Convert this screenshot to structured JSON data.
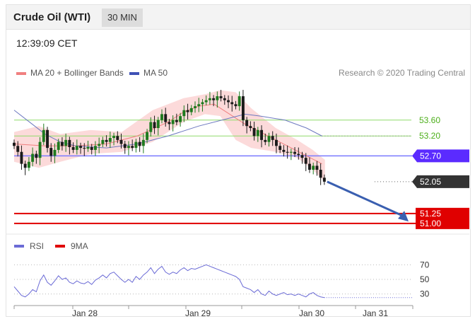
{
  "header": {
    "title": "Crude Oil (WTI)",
    "interval": "30 MIN"
  },
  "timestamp": "12:39:09 CET",
  "legend": {
    "ma20": {
      "label": "MA 20 + Bollinger Bands",
      "color": "#f08080"
    },
    "ma50": {
      "label": "MA 50",
      "color": "#3f51b5"
    },
    "rsi": {
      "label": "RSI",
      "color": "#6b6bd6"
    },
    "ma9": {
      "label": "9MA",
      "color": "#e00000"
    }
  },
  "credit": "Research © 2020 Trading Central",
  "colors": {
    "up": "#1e7a1e",
    "down": "#1a1a1a",
    "band": "#fbd3d3",
    "green_level": "#8fdc6a",
    "blue_level": "#7a7aff",
    "red_level": "#e00000",
    "dark_tag": "#333333",
    "purple_tag": "#5b2bff",
    "arrow": "#3a5fb0"
  },
  "chart_data": [
    {
      "type": "line",
      "name": "price",
      "x_ticks": [
        "Jan 28",
        "Jan 29",
        "Jan 30",
        "Jan 31"
      ],
      "levels": [
        {
          "value": 53.6,
          "label": "53.60",
          "style": "green"
        },
        {
          "value": 53.2,
          "label": "53.20",
          "style": "green"
        },
        {
          "value": 52.7,
          "label": "52.70",
          "style": "blue-tag"
        },
        {
          "value": 52.05,
          "label": "52.05",
          "style": "dark-tag"
        },
        {
          "value": 51.25,
          "label": "51.25",
          "style": "red-tag"
        },
        {
          "value": 51.0,
          "label": "51.00",
          "style": "red-tag"
        }
      ],
      "ylim": [
        50.82,
        54.45
      ],
      "xlim": [
        0,
        130
      ],
      "close": [
        52.95,
        52.8,
        52.5,
        52.4,
        52.55,
        52.75,
        52.65,
        53.05,
        53.35,
        52.9,
        52.7,
        52.85,
        53.05,
        52.95,
        53.1,
        52.92,
        52.85,
        52.95,
        52.9,
        52.88,
        52.92,
        52.85,
        52.95,
        53.0,
        53.1,
        53.05,
        53.15,
        53.2,
        53.1,
        53.0,
        52.9,
        52.95,
        52.9,
        53.05,
        52.95,
        53.1,
        53.3,
        53.55,
        53.4,
        53.6,
        53.75,
        53.55,
        53.5,
        53.6,
        53.55,
        53.7,
        53.85,
        53.8,
        53.9,
        53.95,
        54.0,
        54.05,
        54.1,
        54.15,
        54.1,
        54.2,
        54.15,
        54.1,
        54.05,
        54.0,
        53.95,
        54.2,
        53.6,
        53.45,
        53.4,
        53.2,
        53.35,
        53.1,
        53.05,
        53.2,
        53.1,
        52.95,
        52.85,
        52.8,
        52.78,
        52.8,
        52.75,
        52.72,
        52.65,
        52.5,
        52.35,
        52.45,
        52.35,
        52.15,
        52.05
      ],
      "x_start": 0,
      "x_step": 1.2,
      "ma20": [
        [
          0,
          53.0
        ],
        [
          10,
          52.95
        ],
        [
          20,
          52.95
        ],
        [
          30,
          53.0
        ],
        [
          40,
          53.2
        ],
        [
          50,
          53.55
        ],
        [
          55,
          53.8
        ],
        [
          60,
          53.95
        ],
        [
          65,
          54.0
        ],
        [
          70,
          53.75
        ],
        [
          75,
          53.5
        ],
        [
          80,
          53.3
        ],
        [
          85,
          53.1
        ],
        [
          90,
          52.9
        ],
        [
          95,
          52.7
        ],
        [
          100,
          52.5
        ]
      ],
      "band_upper": [
        [
          0,
          53.3
        ],
        [
          8,
          53.45
        ],
        [
          15,
          53.25
        ],
        [
          25,
          53.35
        ],
        [
          35,
          53.3
        ],
        [
          45,
          53.85
        ],
        [
          55,
          54.15
        ],
        [
          62,
          54.25
        ],
        [
          67,
          54.35
        ],
        [
          72,
          54.3
        ],
        [
          77,
          53.9
        ],
        [
          85,
          53.4
        ],
        [
          92,
          53.1
        ],
        [
          97,
          52.85
        ],
        [
          101,
          52.6
        ]
      ],
      "band_lower": [
        [
          0,
          52.55
        ],
        [
          8,
          52.4
        ],
        [
          15,
          52.55
        ],
        [
          25,
          52.75
        ],
        [
          35,
          52.8
        ],
        [
          45,
          53.05
        ],
        [
          55,
          53.55
        ],
        [
          62,
          53.75
        ],
        [
          67,
          53.7
        ],
        [
          72,
          53.1
        ],
        [
          77,
          52.9
        ],
        [
          85,
          52.8
        ],
        [
          92,
          52.65
        ],
        [
          97,
          52.35
        ],
        [
          101,
          52.05
        ]
      ],
      "ma50": [
        [
          0,
          53.85
        ],
        [
          5,
          53.55
        ],
        [
          10,
          53.25
        ],
        [
          15,
          53.05
        ],
        [
          20,
          52.95
        ],
        [
          30,
          52.9
        ],
        [
          40,
          53.0
        ],
        [
          50,
          53.2
        ],
        [
          60,
          53.45
        ],
        [
          70,
          53.65
        ],
        [
          75,
          53.75
        ],
        [
          80,
          53.7
        ],
        [
          88,
          53.6
        ],
        [
          95,
          53.4
        ],
        [
          100,
          53.2
        ]
      ]
    },
    {
      "type": "line",
      "name": "RSI",
      "y_ticks": [
        30,
        50,
        70
      ],
      "ylim": [
        18,
        82
      ],
      "xlim": [
        0,
        130
      ],
      "x_start": 0,
      "x_step": 1.2,
      "values": [
        40,
        34,
        28,
        26,
        30,
        36,
        33,
        48,
        56,
        46,
        42,
        48,
        55,
        50,
        52,
        46,
        44,
        48,
        45,
        44,
        47,
        43,
        49,
        52,
        56,
        52,
        58,
        60,
        55,
        50,
        46,
        50,
        46,
        54,
        50,
        56,
        60,
        66,
        58,
        64,
        68,
        60,
        57,
        60,
        58,
        63,
        66,
        62,
        65,
        64,
        66,
        68,
        70,
        68,
        66,
        64,
        62,
        60,
        58,
        56,
        54,
        50,
        40,
        38,
        36,
        32,
        36,
        30,
        28,
        34,
        30,
        28,
        30,
        32,
        29,
        30,
        28,
        30,
        28,
        26,
        30,
        32,
        28,
        26,
        25
      ]
    }
  ]
}
